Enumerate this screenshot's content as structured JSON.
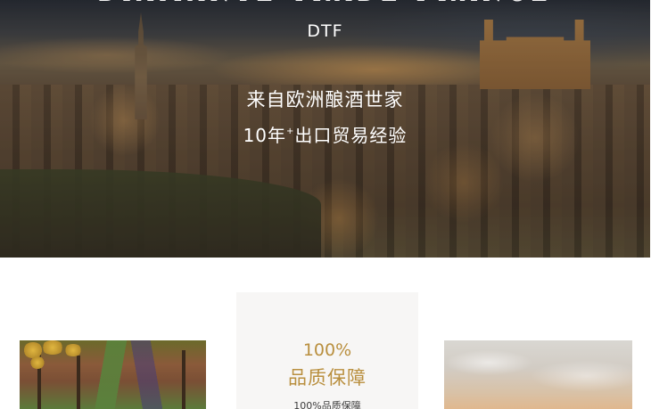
{
  "hero": {
    "top_text": "DIAMANTE TRADE FRANCE",
    "brand": "DTF",
    "tagline_line1": "来自欧洲酿酒世家",
    "tagline_line2_prefix": "10年",
    "tagline_line2_sup": "+",
    "tagline_line2_suffix": "出口贸易经验"
  },
  "features": {
    "center_card": {
      "number": "100%",
      "title": "品质保障",
      "subtitle": "100%品质保障"
    }
  },
  "colors": {
    "accent_gold": "#b98f3e",
    "card_background": "#f7f6f5",
    "text_dark": "#3c3c3c"
  }
}
